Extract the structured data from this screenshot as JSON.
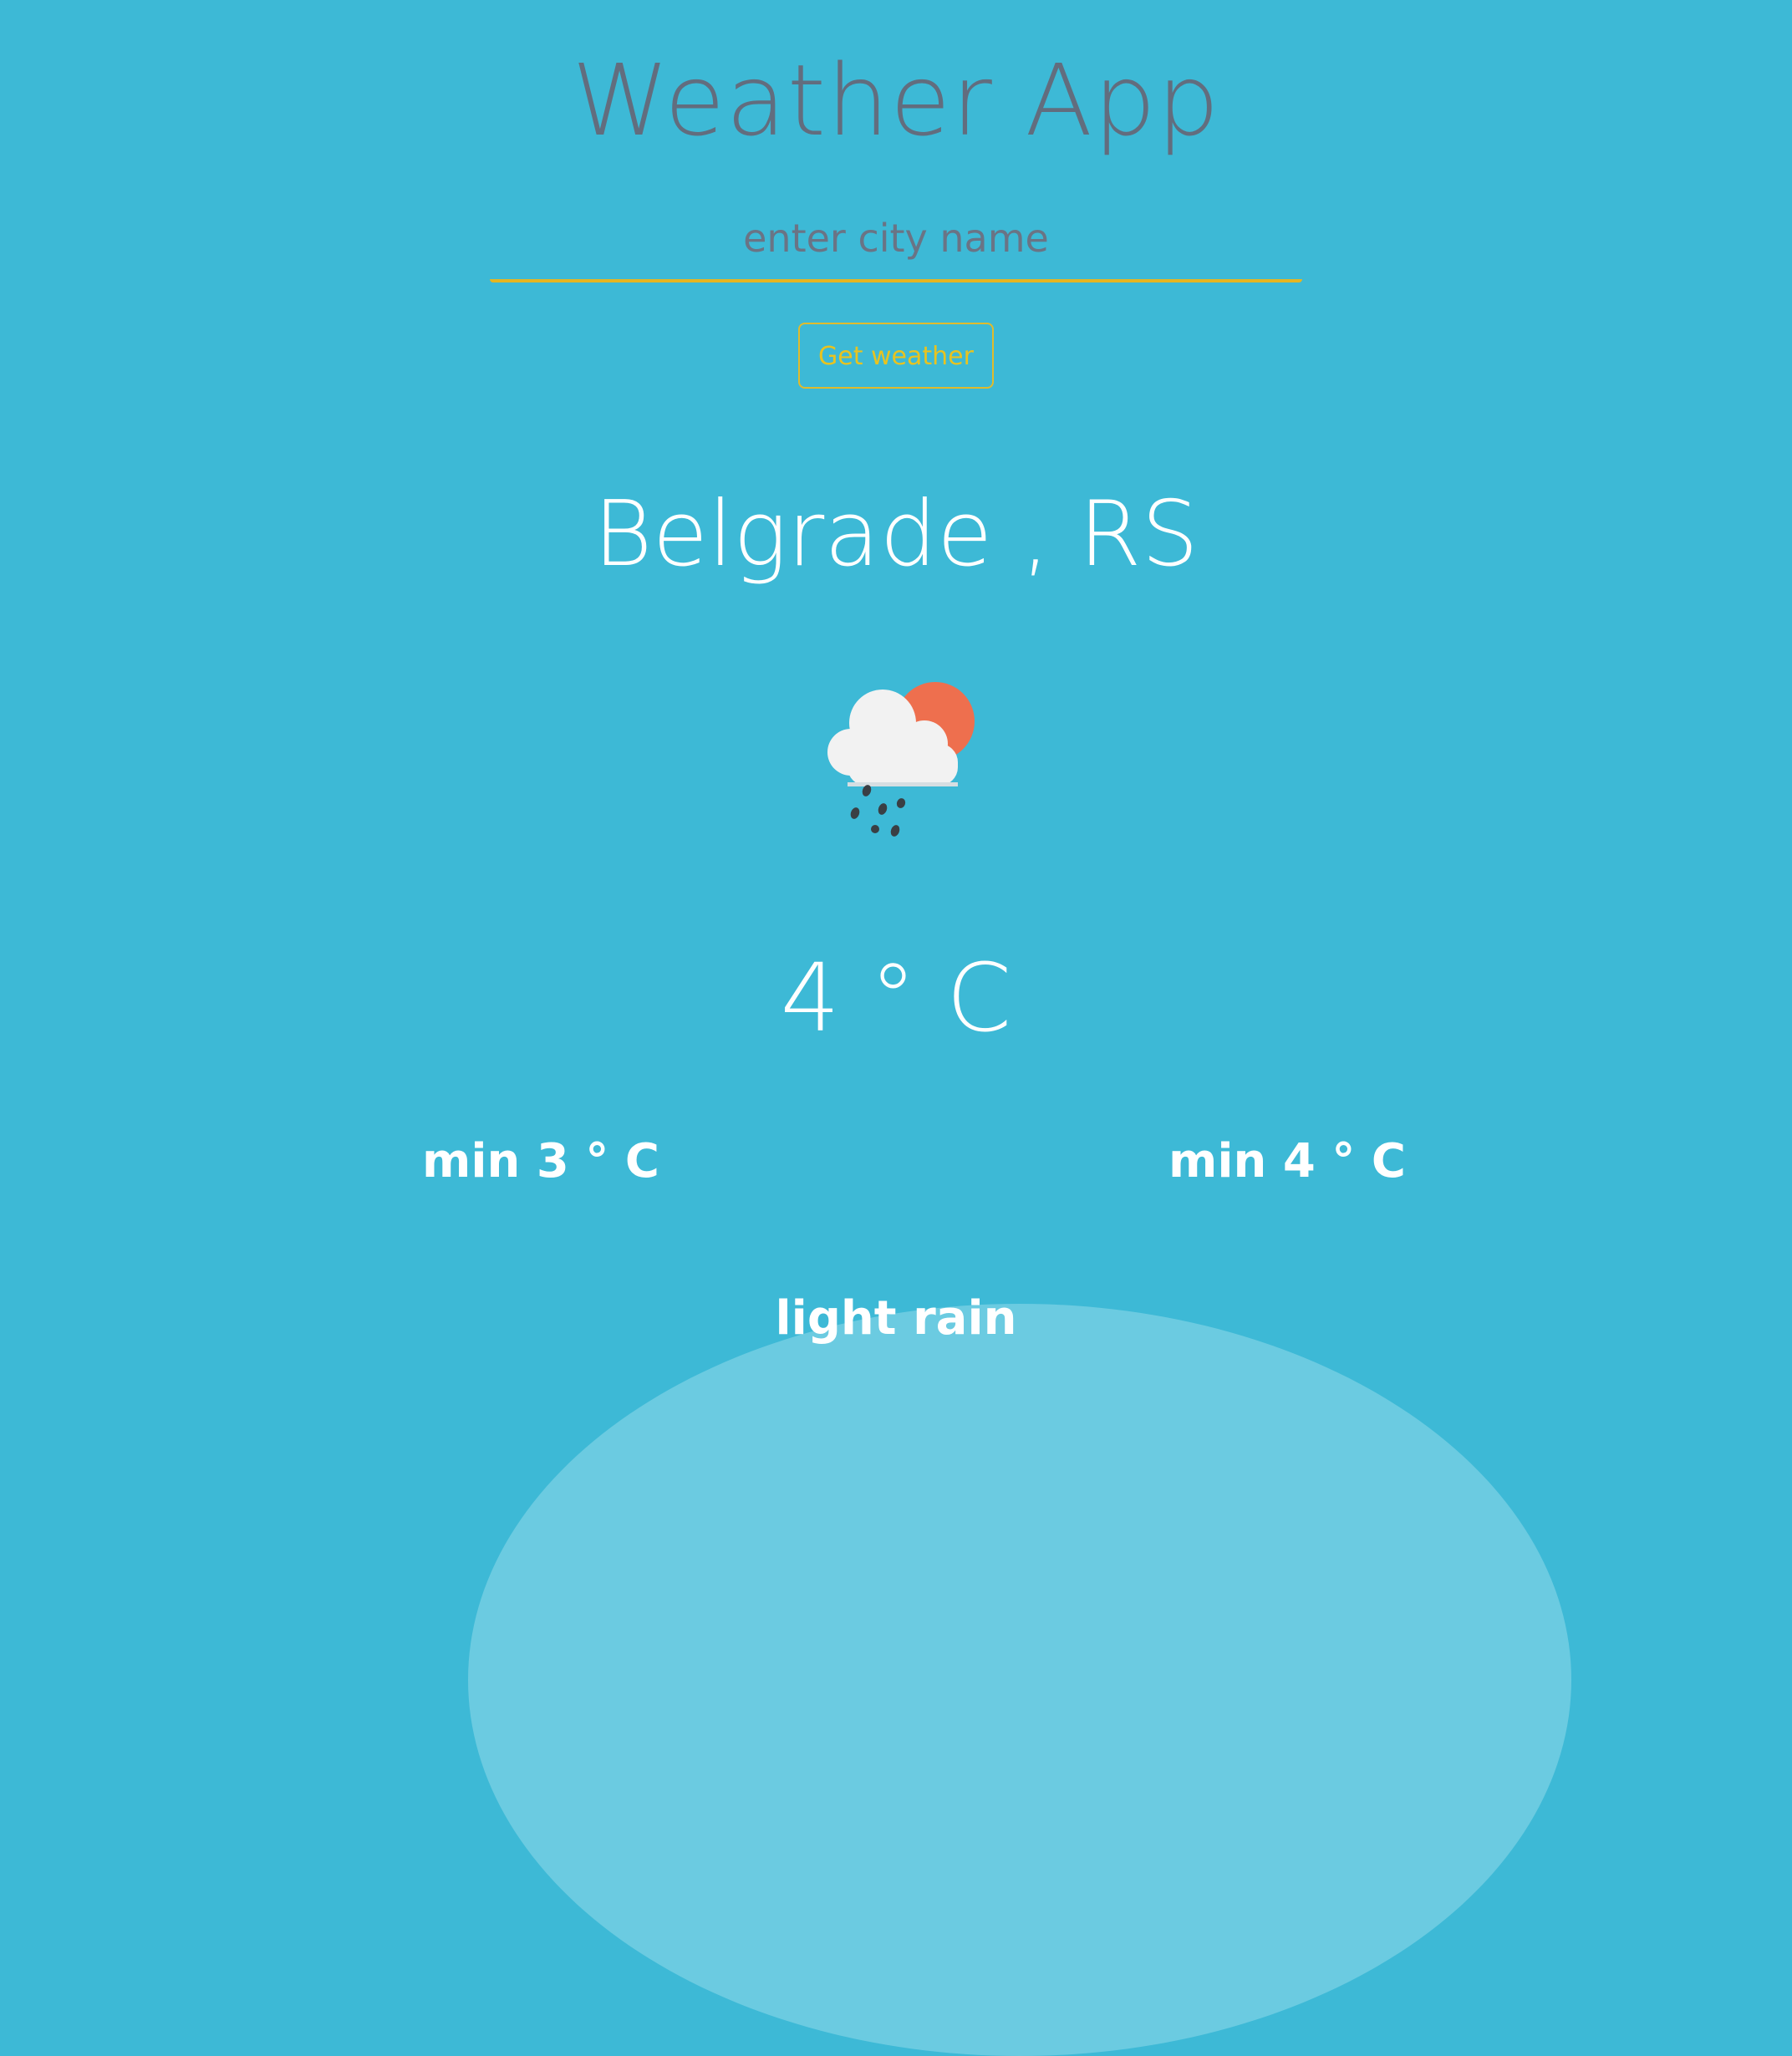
{
  "app": {
    "title": "Weather App"
  },
  "search": {
    "placeholder": "enter city name",
    "value": "",
    "button_label": "Get weather"
  },
  "weather": {
    "location": "Belgrade , RS",
    "icon": "cloud-sun-rain-icon",
    "temperature": "4 ° C",
    "min_left": "min 3 ° C",
    "min_right": "min 4 ° C",
    "description": "light rain"
  },
  "colors": {
    "background": "#3db9d6",
    "accent": "#e5b521",
    "title_text": "#626d7e",
    "sun": "#ee6f4e",
    "cloud": "#f2f2f2"
  }
}
